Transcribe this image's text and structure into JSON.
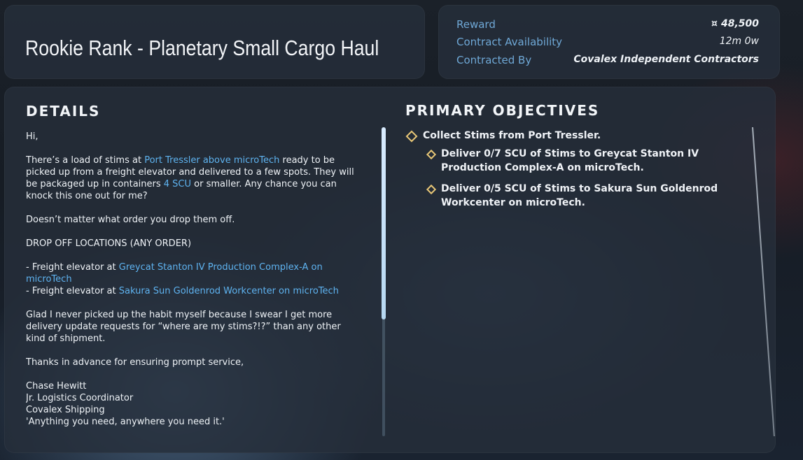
{
  "contract": {
    "title": "Rookie Rank - Planetary Small Cargo Haul"
  },
  "info": {
    "reward_label": "Reward",
    "reward_icon": "¤",
    "reward_value": "48,500",
    "availability_label": "Contract Availability",
    "availability_value": "12m 0w",
    "contracted_by_label": "Contracted By",
    "contracted_by_value": "Covalex Independent Contractors"
  },
  "details": {
    "heading": "DETAILS",
    "greeting": "Hi,",
    "p1_a": "There’s a load of stims at ",
    "p1_link1": "Port Tressler above microTech",
    "p1_b": " ready to be picked up from a freight elevator and delivered to a few spots. They will be packaged up in containers ",
    "p1_link2": "4 SCU",
    "p1_c": " or smaller. Any chance you can knock this one out for me?",
    "p2": "Doesn’t matter what order you drop them off.",
    "p3": "DROP OFF LOCATIONS (ANY ORDER)",
    "loc1_prefix": "- Freight elevator at ",
    "loc1_link": "Greycat Stanton IV Production Complex-A on microTech",
    "loc2_prefix": "- Freight elevator at ",
    "loc2_link": "Sakura Sun Goldenrod Workcenter on microTech",
    "p4": "Glad I never picked up the habit myself because I swear I get more delivery update requests for “where are my stims?!?” than any other kind of shipment.",
    "p5": "Thanks in advance for ensuring prompt service,",
    "sig_name": "Chase Hewitt",
    "sig_title": "Jr. Logistics Coordinator",
    "sig_company": "Covalex Shipping",
    "sig_motto": "'Anything you need, anywhere you need it.'"
  },
  "objectives": {
    "heading": "PRIMARY OBJECTIVES",
    "main": "Collect Stims from Port Tressler.",
    "sub1": "Deliver 0/7 SCU of Stims to Greycat Stanton IV Production Complex-A on microTech.",
    "sub2": "Deliver 0/5 SCU of Stims to Sakura Sun Goldenrod Workcenter on microTech."
  },
  "colors": {
    "accent_link": "#5eb3f0",
    "label_blue": "#6fa8d6",
    "objective_diamond": "#e8c777"
  },
  "icons": {
    "reward": "currency-icon",
    "objective": "diamond-icon"
  }
}
